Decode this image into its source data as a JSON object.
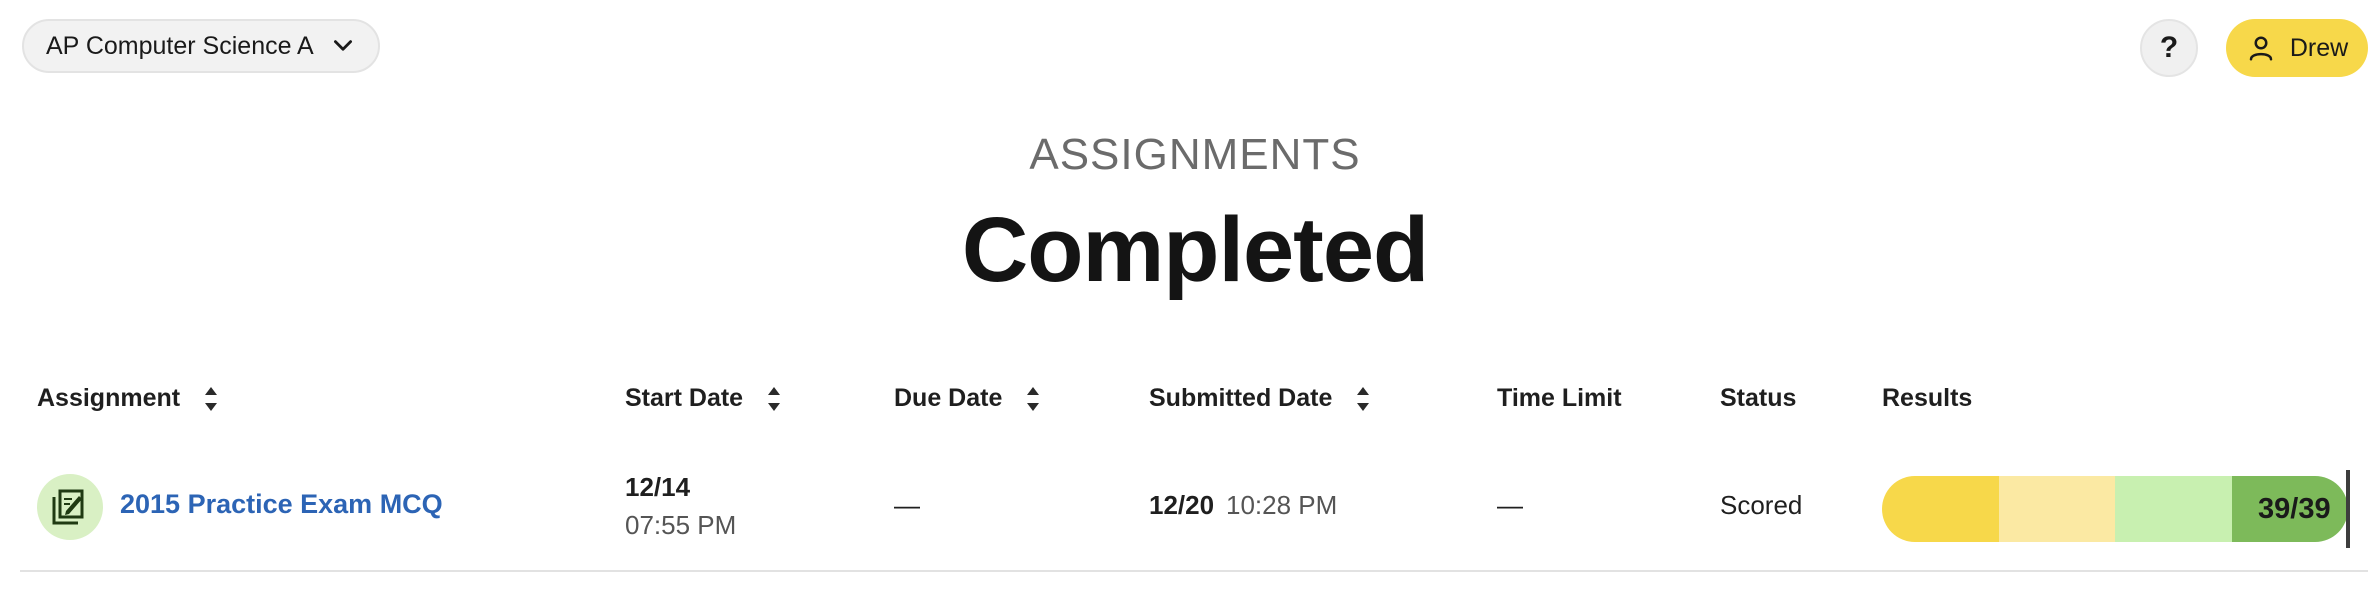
{
  "header": {
    "course_label": "AP Computer Science A",
    "help_label": "?",
    "user_name": "Drew",
    "accent_color": "#f7d84a"
  },
  "page": {
    "eyebrow": "ASSIGNMENTS",
    "title": "Completed"
  },
  "table": {
    "columns": {
      "assignment": "Assignment",
      "start_date": "Start Date",
      "due_date": "Due Date",
      "submitted_date": "Submitted Date",
      "time_limit": "Time Limit",
      "status": "Status",
      "results": "Results"
    },
    "rows": [
      {
        "assignment": "2015 Practice Exam MCQ",
        "assignment_icon": "edit-document-icon",
        "start_date": "12/14",
        "start_time": "07:55 PM",
        "due_date": "—",
        "submitted_date": "12/20",
        "submitted_time": "10:28 PM",
        "time_limit": "—",
        "status": "Scored",
        "score": "39/39",
        "score_fraction": 1.0
      }
    ]
  },
  "results_bar_colors": [
    "#f7d84a",
    "#fbe9a3",
    "#c8f0b0",
    "#7dba5a"
  ],
  "link_color": "#2c64b5"
}
